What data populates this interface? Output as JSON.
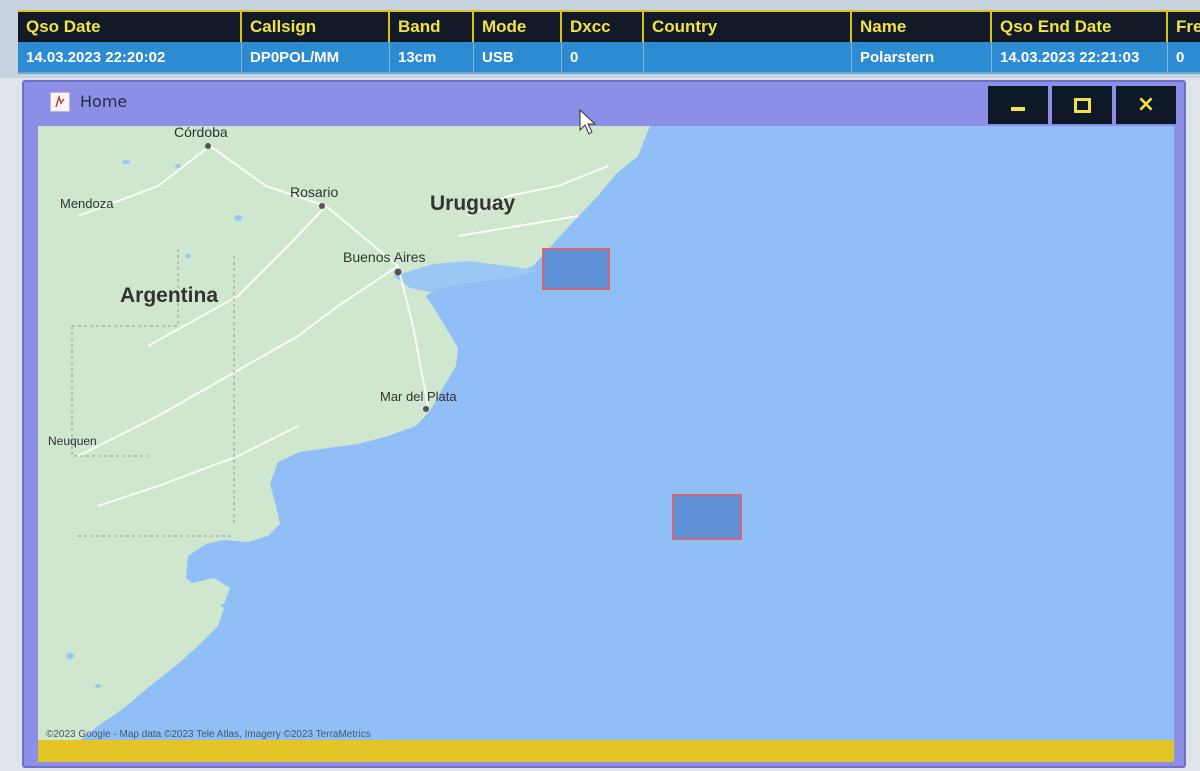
{
  "log_grid": {
    "columns": [
      "Qso Date",
      "Callsign",
      "Band",
      "Mode",
      "Dxcc",
      "Country",
      "Name",
      "Qso End Date",
      "Fre"
    ],
    "selected_row": {
      "qso_date": "14.03.2023 22:20:02",
      "callsign": "DP0POL/MM",
      "band": "13cm",
      "mode": "USB",
      "dxcc": "0",
      "country": "",
      "name": "Polarstern",
      "qso_end_date": "14.03.2023 22:21:03",
      "fre": "0"
    }
  },
  "map_window": {
    "title": "Home",
    "icon": "app-logo-icon",
    "buttons": {
      "minimize": "minimize-icon",
      "maximize": "maximize-icon",
      "close": "close-icon"
    },
    "map": {
      "labels": {
        "cordoba": "Córdoba",
        "mendoza": "Mendoza",
        "rosario": "Rosario",
        "uruguay": "Uruguay",
        "buenos_aires": "Buenos Aires",
        "argentina": "Argentina",
        "mar_del_plata": "Mar del Plata",
        "neuquen": "Neuquen"
      },
      "attribution": "©2023 Google - Map data ©2023 Tele Atlas, Imagery ©2023 TerraMetrics",
      "colors": {
        "land": "#cfe6cf",
        "water": "#8fbff6",
        "marker_fill": "#5f8fd4",
        "marker_border": "#d2686f"
      }
    }
  },
  "colors": {
    "grid_header_bg": "#111a26",
    "grid_header_text": "#f2e24a",
    "selected_row_bg": "#2d8bd1",
    "window_bg": "#8d8fe6",
    "statusbar": "#e4c528"
  }
}
